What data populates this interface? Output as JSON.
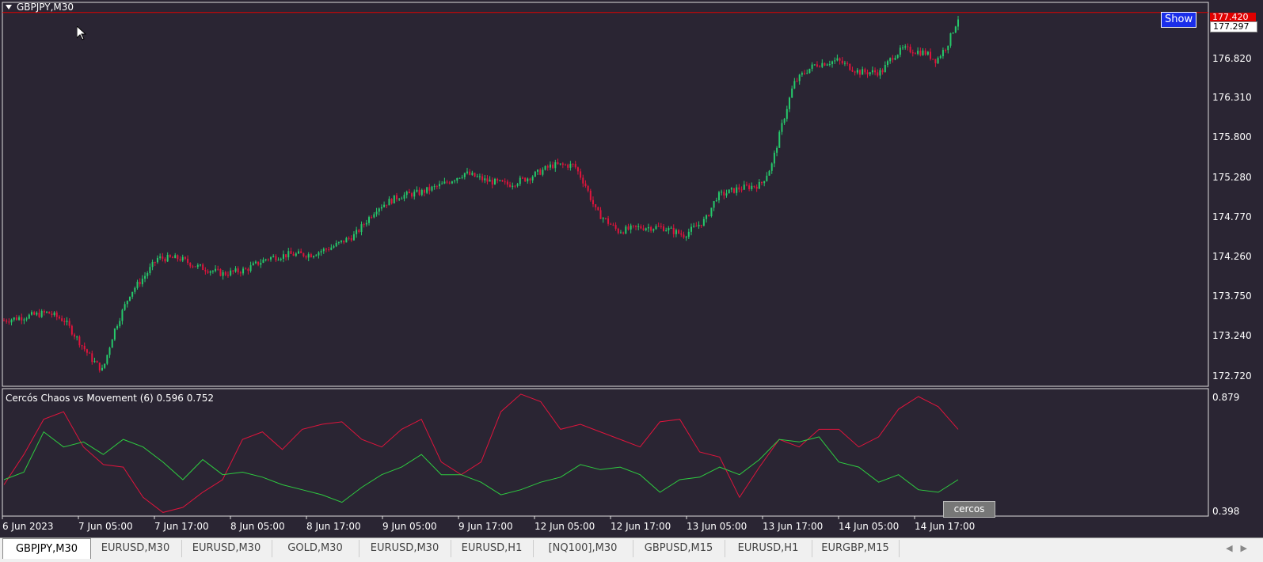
{
  "chart": {
    "symbol_label": "GBPJPY,M30",
    "y_ticks": [
      "176.820",
      "176.310",
      "175.800",
      "175.280",
      "174.770",
      "174.260",
      "173.750",
      "173.240",
      "172.720"
    ],
    "ask_price": "177.420",
    "bid_price": "177.297",
    "show_button": "Show",
    "x_ticks": [
      "6 Jun 2023",
      "7 Jun 05:00",
      "7 Jun 17:00",
      "8 Jun 05:00",
      "8 Jun 17:00",
      "9 Jun 05:00",
      "9 Jun 17:00",
      "12 Jun 05:00",
      "12 Jun 17:00",
      "13 Jun 05:00",
      "13 Jun 17:00",
      "14 Jun 05:00",
      "14 Jun 17:00"
    ]
  },
  "indicator": {
    "label": "Cercós Chaos vs Movement (6) 0.596 0.752",
    "y_max": "0.879",
    "y_min": "0.398",
    "button": "cercos"
  },
  "tabs": [
    "GBPJPY,M30",
    "EURUSD,M30",
    "EURUSD,M30",
    "GOLD,M30",
    "EURUSD,M30",
    "EURUSD,H1",
    "[NQ100],M30",
    "GBPUSD,M15",
    "EURUSD,H1",
    "EURGBP,M15"
  ],
  "colors": {
    "background": "#2a2533",
    "bull": "#26c96b",
    "bear": "#e0143c",
    "chaos_line": "#e0143c",
    "movement_line": "#2ecc40",
    "ask_line": "#e00000"
  },
  "chart_data": [
    {
      "type": "candlestick",
      "title": "GBPJPY,M30",
      "ylim": [
        172.6,
        177.55
      ],
      "x_labels": [
        "6 Jun 2023",
        "7 Jun 05:00",
        "7 Jun 17:00",
        "8 Jun 05:00",
        "8 Jun 17:00",
        "9 Jun 05:00",
        "9 Jun 17:00",
        "12 Jun 05:00",
        "12 Jun 17:00",
        "13 Jun 05:00",
        "13 Jun 17:00",
        "14 Jun 05:00",
        "14 Jun 17:00"
      ],
      "close_path": [
        [
          0,
          173.45
        ],
        [
          4,
          173.5
        ],
        [
          8,
          173.55
        ],
        [
          11,
          173.45
        ],
        [
          14,
          173.15
        ],
        [
          16,
          172.95
        ],
        [
          18,
          172.8
        ],
        [
          20,
          173.3
        ],
        [
          23,
          173.8
        ],
        [
          26,
          174.05
        ],
        [
          28,
          174.25
        ],
        [
          32,
          174.25
        ],
        [
          35,
          174.15
        ],
        [
          40,
          174.05
        ],
        [
          44,
          174.1
        ],
        [
          48,
          174.25
        ],
        [
          52,
          174.3
        ],
        [
          56,
          174.3
        ],
        [
          60,
          174.4
        ],
        [
          64,
          174.55
        ],
        [
          68,
          174.9
        ],
        [
          72,
          175.05
        ],
        [
          76,
          175.1
        ],
        [
          80,
          175.2
        ],
        [
          84,
          175.35
        ],
        [
          88,
          175.25
        ],
        [
          92,
          175.2
        ],
        [
          96,
          175.3
        ],
        [
          100,
          175.45
        ],
        [
          104,
          175.45
        ],
        [
          106,
          175.2
        ],
        [
          108,
          174.85
        ],
        [
          112,
          174.6
        ],
        [
          116,
          174.65
        ],
        [
          120,
          174.65
        ],
        [
          124,
          174.55
        ],
        [
          128,
          174.75
        ],
        [
          130,
          175.05
        ],
        [
          134,
          175.15
        ],
        [
          138,
          175.2
        ],
        [
          140,
          175.45
        ],
        [
          142,
          176.0
        ],
        [
          144,
          176.5
        ],
        [
          146,
          176.65
        ],
        [
          148,
          176.75
        ],
        [
          152,
          176.8
        ],
        [
          156,
          176.65
        ],
        [
          160,
          176.65
        ],
        [
          162,
          176.85
        ],
        [
          164,
          176.95
        ],
        [
          168,
          176.9
        ],
        [
          170,
          176.8
        ],
        [
          172,
          177.0
        ],
        [
          174,
          177.35
        ]
      ]
    },
    {
      "type": "line",
      "title": "Cercós Chaos vs Movement (6)",
      "ylim": [
        0.398,
        0.879
      ],
      "series": [
        {
          "color": "#e0143c",
          "values": [
            0.51,
            0.63,
            0.77,
            0.8,
            0.66,
            0.59,
            0.58,
            0.46,
            0.4,
            0.42,
            0.48,
            0.53,
            0.69,
            0.72,
            0.65,
            0.73,
            0.75,
            0.76,
            0.69,
            0.66,
            0.73,
            0.77,
            0.6,
            0.55,
            0.6,
            0.8,
            0.87,
            0.84,
            0.73,
            0.75,
            0.72,
            0.69,
            0.66,
            0.76,
            0.77,
            0.64,
            0.62,
            0.46,
            0.58,
            0.69,
            0.66,
            0.73,
            0.73,
            0.66,
            0.7,
            0.81,
            0.86,
            0.82,
            0.73
          ]
        },
        {
          "color": "#2ecc40",
          "values": [
            0.53,
            0.56,
            0.72,
            0.66,
            0.68,
            0.63,
            0.69,
            0.66,
            0.6,
            0.53,
            0.61,
            0.55,
            0.56,
            0.54,
            0.51,
            0.49,
            0.47,
            0.44,
            0.5,
            0.55,
            0.58,
            0.63,
            0.55,
            0.55,
            0.52,
            0.47,
            0.49,
            0.52,
            0.54,
            0.59,
            0.57,
            0.58,
            0.55,
            0.48,
            0.53,
            0.54,
            0.58,
            0.55,
            0.61,
            0.69,
            0.68,
            0.7,
            0.6,
            0.58,
            0.52,
            0.55,
            0.49,
            0.48,
            0.53
          ]
        }
      ]
    }
  ]
}
